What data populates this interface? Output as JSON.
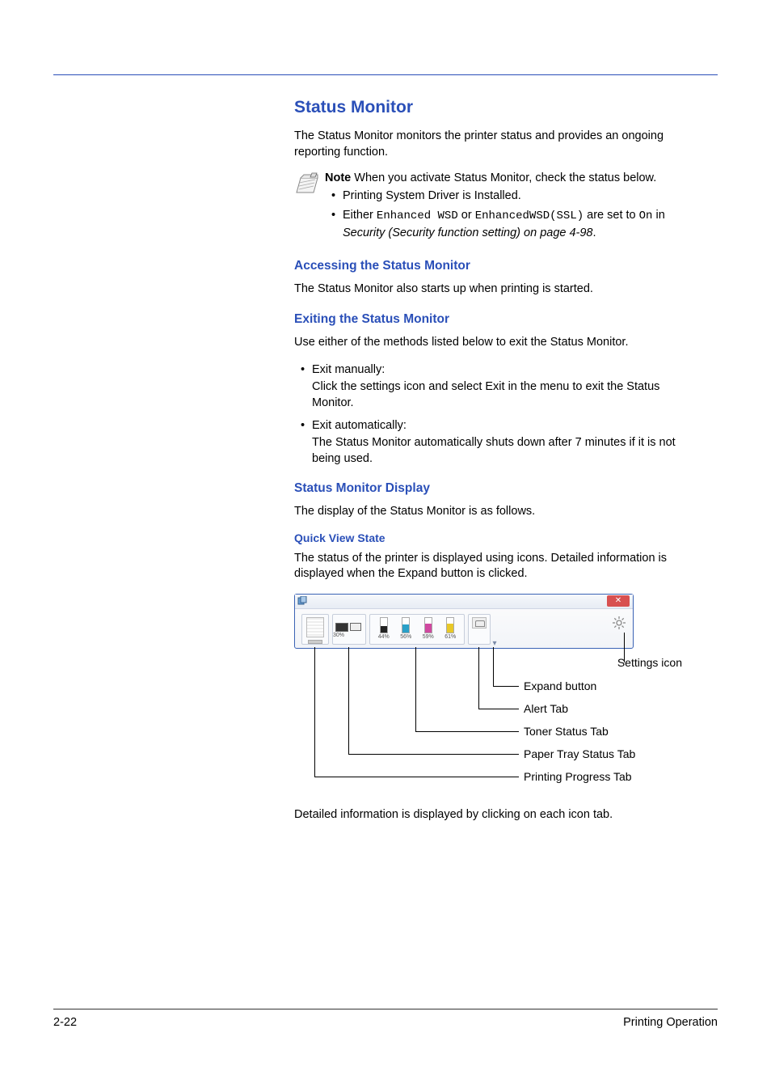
{
  "heading": "Status Monitor",
  "intro": "The Status Monitor monitors the printer status and provides an ongoing reporting function.",
  "note": {
    "label": "Note",
    "lead": "  When you activate Status Monitor, check the status below.",
    "b1": "Printing System Driver is Installed.",
    "b2_pre": "Either ",
    "b2_code1": "Enhanced WSD",
    "b2_mid": " or ",
    "b2_code2": "EnhancedWSD(SSL)",
    "b2_mid2": " are set to ",
    "b2_code3": "On",
    "b2_post_in": " in ",
    "b2_ref": "Security (Security function setting) on page 4-98",
    "b2_end": "."
  },
  "sec1": {
    "title": "Accessing the Status Monitor",
    "text": "The Status Monitor also starts up when printing is started."
  },
  "sec2": {
    "title": "Exiting the Status Monitor",
    "text": "Use either of the methods listed below to exit the Status Monitor.",
    "li1a": "Exit manually:",
    "li1b": "Click the settings icon and select Exit in the menu to exit the Status Monitor.",
    "li2a": "Exit automatically:",
    "li2b": "The Status Monitor automatically shuts down after 7 minutes if it is not being used."
  },
  "sec3": {
    "title": "Status Monitor Display",
    "text": "The display of the Status Monitor is as follows."
  },
  "sec4": {
    "title": "Quick View State",
    "text": "The status of the printer is displayed using icons. Detailed information is displayed when the Expand button is clicked."
  },
  "toner": {
    "p1": "30%",
    "p2": "44%",
    "p3": "56%",
    "p4": "59%",
    "p5": "61%"
  },
  "labels": {
    "settings": "Settings icon",
    "expand": "Expand button",
    "alert": "Alert Tab",
    "toner": "Toner Status Tab",
    "paper": "Paper Tray Status Tab",
    "progress": "Printing Progress Tab"
  },
  "outro": "Detailed information is displayed by clicking on each icon tab.",
  "footer": {
    "page": "2-22",
    "section": "Printing Operation"
  },
  "close_glyph": "✕"
}
